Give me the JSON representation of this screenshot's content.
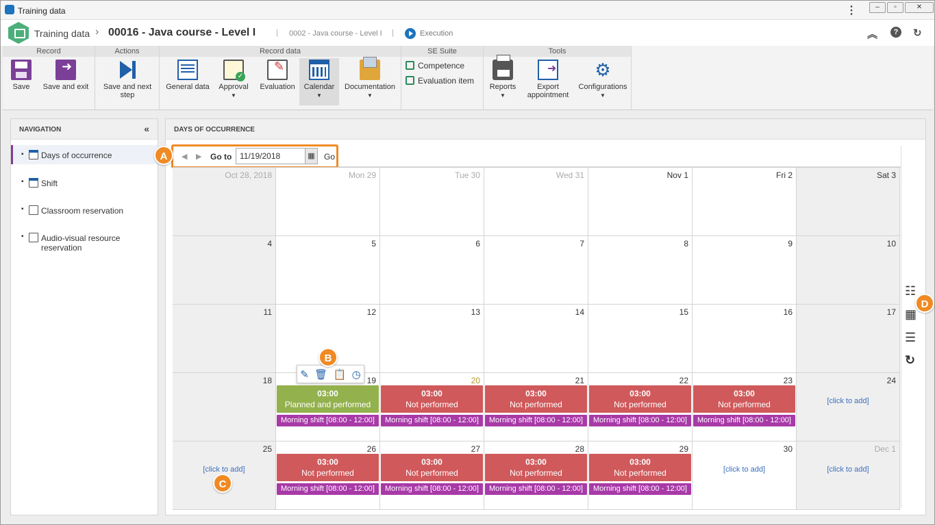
{
  "window": {
    "title": "Training data"
  },
  "header": {
    "module": "Training data",
    "record_title": "00016 - Java course - Level I",
    "subtitle": "0002 - Java course - Level I",
    "status": "Execution"
  },
  "ribbon": {
    "groups": {
      "record": "Record",
      "actions": "Actions",
      "record_data": "Record data",
      "se_suite": "SE Suite",
      "tools": "Tools"
    },
    "save": "Save",
    "save_exit": "Save and exit",
    "save_next": "Save and next step",
    "general_data": "General data",
    "approval": "Approval",
    "evaluation": "Evaluation",
    "calendar": "Calendar",
    "documentation": "Documentation",
    "competence": "Competence",
    "evaluation_item": "Evaluation item",
    "reports": "Reports",
    "export_appointment": "Export appointment",
    "configurations": "Configurations"
  },
  "navigation": {
    "title": "NAVIGATION",
    "items": [
      {
        "label": "Days of occurrence"
      },
      {
        "label": "Shift"
      },
      {
        "label": "Classroom reservation"
      },
      {
        "label": "Audio-visual resource reservation"
      }
    ]
  },
  "main": {
    "title": "DAYS OF OCCURRENCE",
    "goto_label": "Go to",
    "goto_value": "11/19/2018",
    "go": "Go"
  },
  "calendar": {
    "weeks": [
      [
        {
          "d": "Oct 28, 2018",
          "dim": true,
          "shade": true
        },
        {
          "d": "Mon 29",
          "dim": true
        },
        {
          "d": "Tue 30",
          "dim": true
        },
        {
          "d": "Wed 31",
          "dim": true
        },
        {
          "d": "Nov 1"
        },
        {
          "d": "Fri 2"
        },
        {
          "d": "Sat 3",
          "shade": true
        }
      ],
      [
        {
          "d": "4",
          "shade": true
        },
        {
          "d": "5"
        },
        {
          "d": "6"
        },
        {
          "d": "7"
        },
        {
          "d": "8"
        },
        {
          "d": "9"
        },
        {
          "d": "10",
          "shade": true
        }
      ],
      [
        {
          "d": "11",
          "shade": true
        },
        {
          "d": "12"
        },
        {
          "d": "13"
        },
        {
          "d": "14"
        },
        {
          "d": "15"
        },
        {
          "d": "16"
        },
        {
          "d": "17",
          "shade": true
        }
      ],
      [
        {
          "d": "18",
          "shade": true
        },
        {
          "d": "19",
          "ev": "green",
          "time": "03:00",
          "status": "Planned and performed",
          "shift": "Morning shift [08:00 - 12:00]"
        },
        {
          "d": "20",
          "today": true,
          "ev": "red",
          "time": "03:00",
          "status": "Not performed",
          "shift": "Morning shift [08:00 - 12:00]"
        },
        {
          "d": "21",
          "ev": "red",
          "time": "03:00",
          "status": "Not performed",
          "shift": "Morning shift [08:00 - 12:00]"
        },
        {
          "d": "22",
          "ev": "red",
          "time": "03:00",
          "status": "Not performed",
          "shift": "Morning shift [08:00 - 12:00]"
        },
        {
          "d": "23",
          "ev": "red",
          "time": "03:00",
          "status": "Not performed",
          "shift": "Morning shift [08:00 - 12:00]"
        },
        {
          "d": "24",
          "shade": true,
          "add": "[click to add]"
        }
      ],
      [
        {
          "d": "25",
          "shade": true,
          "add": "[click to add]"
        },
        {
          "d": "26",
          "ev": "red",
          "time": "03:00",
          "status": "Not performed",
          "shift": "Morning shift [08:00 - 12:00]"
        },
        {
          "d": "27",
          "ev": "red",
          "time": "03:00",
          "status": "Not performed",
          "shift": "Morning shift [08:00 - 12:00]"
        },
        {
          "d": "28",
          "ev": "red",
          "time": "03:00",
          "status": "Not performed",
          "shift": "Morning shift [08:00 - 12:00]"
        },
        {
          "d": "29",
          "ev": "red",
          "time": "03:00",
          "status": "Not performed",
          "shift": "Morning shift [08:00 - 12:00]"
        },
        {
          "d": "30",
          "add": "[click to add]"
        },
        {
          "d": "Dec 1",
          "dim": true,
          "shade": true,
          "add": "[click to add]"
        }
      ]
    ]
  },
  "markers": {
    "a": "A",
    "b": "B",
    "c": "C",
    "d": "D"
  },
  "colors": {
    "accent": "#f08a24",
    "not_performed": "#d0595b",
    "performed": "#93b14d",
    "shift": "#a83aa8"
  }
}
